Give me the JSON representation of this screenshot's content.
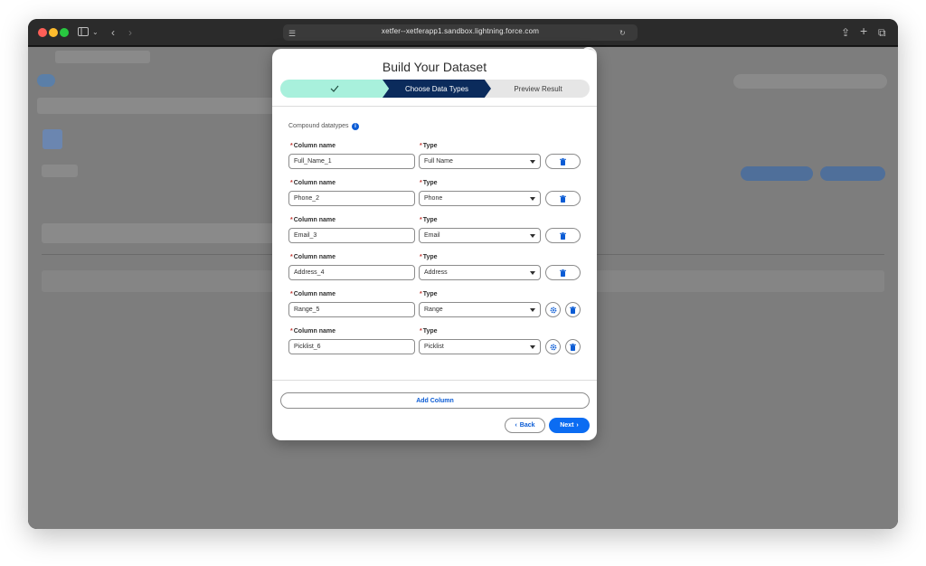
{
  "browser": {
    "url": "xetfer--xetferapp1.sandbox.lightning.force.com"
  },
  "modal": {
    "title": "Build Your Dataset",
    "path": {
      "step1_icon": "checkmark-icon",
      "step2_label": "Choose Data Types",
      "step3_label": "Preview Result"
    },
    "section_label": "Compound datatypes",
    "column_label": "Column name",
    "type_label": "Type",
    "rows": [
      {
        "column_value": "Full_Name_1",
        "type_value": "Full Name",
        "has_settings": false
      },
      {
        "column_value": "Phone_2",
        "type_value": "Phone",
        "has_settings": false
      },
      {
        "column_value": "Email_3",
        "type_value": "Email",
        "has_settings": false
      },
      {
        "column_value": "Address_4",
        "type_value": "Address",
        "has_settings": false
      },
      {
        "column_value": "Range_5",
        "type_value": "Range",
        "has_settings": true
      },
      {
        "column_value": "Picklist_6",
        "type_value": "Picklist",
        "has_settings": true
      }
    ],
    "add_column_label": "Add Column",
    "back_label": "Back",
    "next_label": "Next"
  },
  "colors": {
    "accent": "#0b6cf2",
    "path_current": "#0b2b5c",
    "path_done": "#a8f0dc",
    "required": "#c23934"
  }
}
